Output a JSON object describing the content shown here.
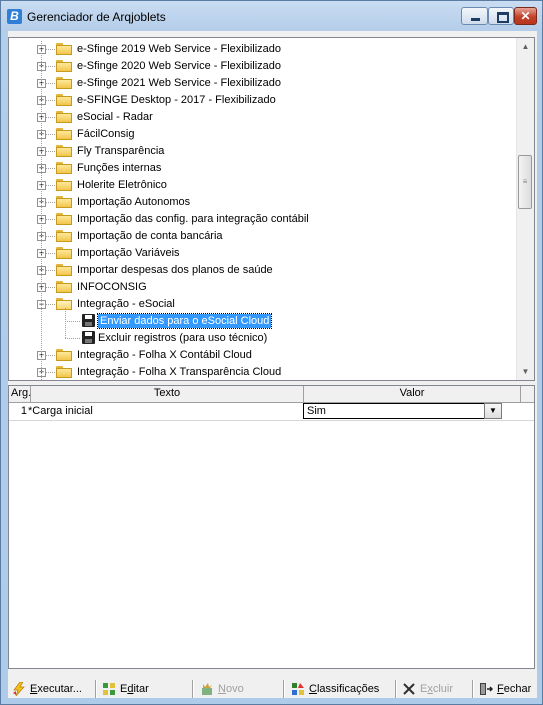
{
  "window": {
    "title": "Gerenciador de Arqjoblets",
    "app_icon_letter": "B",
    "close_glyph": "✕"
  },
  "tree": {
    "items": [
      {
        "label": "e-Sfinge 2019 Web Service - Flexibilizado",
        "type": "folder",
        "expander": "+"
      },
      {
        "label": "e-Sfinge 2020 Web Service - Flexibilizado",
        "type": "folder",
        "expander": "+"
      },
      {
        "label": "e-Sfinge 2021 Web Service - Flexibilizado",
        "type": "folder",
        "expander": "+"
      },
      {
        "label": "e-SFINGE Desktop - 2017 - Flexibilizado",
        "type": "folder",
        "expander": "+"
      },
      {
        "label": "eSocial - Radar",
        "type": "folder",
        "expander": "+"
      },
      {
        "label": "FácilConsig",
        "type": "folder",
        "expander": "+"
      },
      {
        "label": "Fly Transparência",
        "type": "folder",
        "expander": "+"
      },
      {
        "label": "Funções internas",
        "type": "folder",
        "expander": "+"
      },
      {
        "label": "Holerite Eletrônico",
        "type": "folder",
        "expander": "+"
      },
      {
        "label": "Importação Autonomos",
        "type": "folder",
        "expander": "+"
      },
      {
        "label": "Importação das config. para integração contábil",
        "type": "folder",
        "expander": "+"
      },
      {
        "label": "Importação de conta bancária",
        "type": "folder",
        "expander": "+"
      },
      {
        "label": "Importação Variáveis",
        "type": "folder",
        "expander": "+"
      },
      {
        "label": "Importar despesas dos planos de saúde",
        "type": "folder",
        "expander": "+"
      },
      {
        "label": "INFOCONSIG",
        "type": "folder",
        "expander": "+"
      },
      {
        "label": "Integração - eSocial",
        "type": "folder-open",
        "expander": "−"
      },
      {
        "label": "Enviar dados para o eSocial Cloud",
        "type": "item",
        "selected": true
      },
      {
        "label": "Excluir registros (para uso técnico)",
        "type": "item"
      },
      {
        "label": "Integração - Folha X Contábil Cloud",
        "type": "folder",
        "expander": "+"
      },
      {
        "label": "Integração - Folha X Transparência Cloud",
        "type": "folder",
        "expander": "+"
      }
    ]
  },
  "grid": {
    "headers": {
      "arg": "Arg.",
      "text": "Texto",
      "value": "Valor"
    },
    "rows": [
      {
        "num": "1",
        "text": "*Carga inicial",
        "value": "Sim"
      }
    ]
  },
  "toolbar": {
    "executar": {
      "label": "Executar...",
      "underline": "E",
      "rest": "xecutar..."
    },
    "editar": {
      "pre": "E",
      "underline": "d",
      "rest": "itar"
    },
    "novo": {
      "underline": "N",
      "rest": "ovo"
    },
    "classificacoes": {
      "underline": "C",
      "rest": "lassificações"
    },
    "excluir": {
      "pre": "E",
      "underline": "x",
      "rest": "cluir"
    },
    "fechar": {
      "underline": "F",
      "rest": "echar"
    }
  },
  "colors": {
    "selection": "#3399ff",
    "folder": "#f1c64c",
    "close_button": "#c4412a"
  }
}
